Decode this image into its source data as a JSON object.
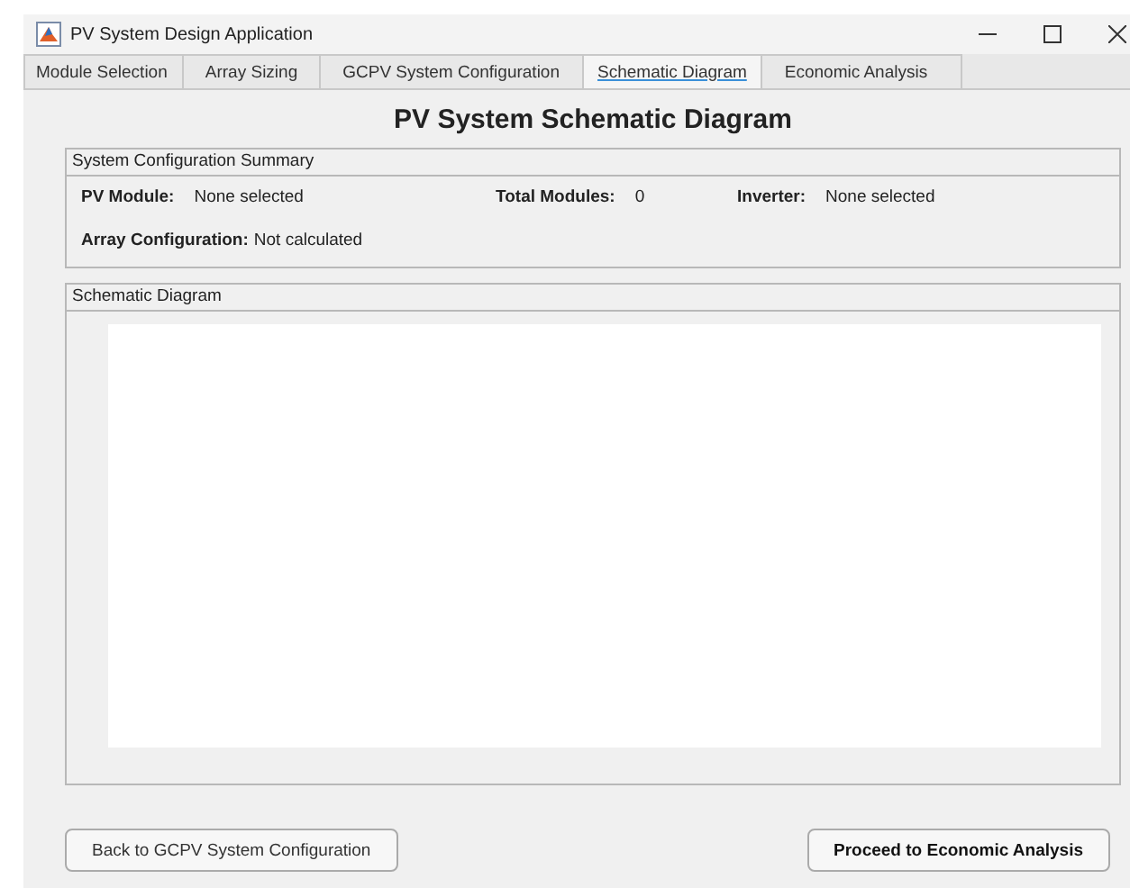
{
  "window": {
    "title": "PV System Design Application"
  },
  "tabs": [
    {
      "label": "Module Selection",
      "selected": false
    },
    {
      "label": "Array Sizing",
      "selected": false
    },
    {
      "label": "GCPV System Configuration",
      "selected": false
    },
    {
      "label": "Schematic Diagram",
      "selected": true
    },
    {
      "label": "Economic Analysis",
      "selected": false
    }
  ],
  "heading": "PV System Schematic Diagram",
  "summary": {
    "title": "System Configuration Summary",
    "pv_module": {
      "label": "PV Module:",
      "value": "None selected"
    },
    "total_modules": {
      "label": "Total Modules:",
      "value": "0"
    },
    "inverter": {
      "label": "Inverter:",
      "value": "None selected"
    },
    "array_configuration": {
      "label": "Array Configuration:",
      "value": "Not calculated"
    }
  },
  "schematic": {
    "title": "Schematic Diagram"
  },
  "buttons": [
    {
      "label": "Back to GCPV System Configuration",
      "kind": "plain"
    },
    {
      "label": "Proceed to Economic Analysis",
      "kind": "primary"
    }
  ]
}
